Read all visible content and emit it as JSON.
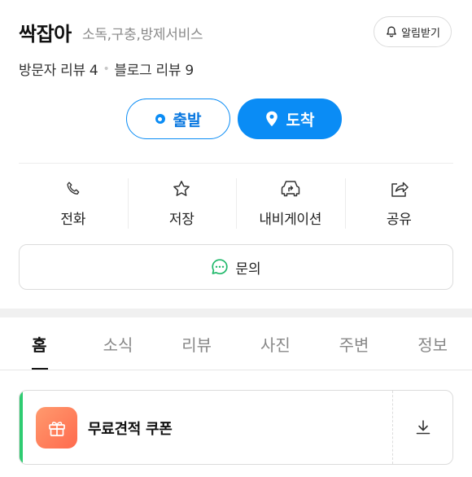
{
  "place": {
    "name": "싹잡아",
    "category": "소독,구충,방제서비스",
    "alarm_label": "알림받기",
    "visitor_reviews": "방문자 리뷰 4",
    "blog_reviews": "블로그 리뷰 9",
    "separator": "•"
  },
  "route": {
    "depart_label": "출발",
    "arrive_label": "도착"
  },
  "actions": [
    {
      "label": "전화",
      "icon": "phone-icon"
    },
    {
      "label": "저장",
      "icon": "star-icon"
    },
    {
      "label": "내비게이션",
      "icon": "navigation-car-icon"
    },
    {
      "label": "공유",
      "icon": "share-icon"
    }
  ],
  "inquiry": {
    "label": "문의",
    "icon": "chat-bubble-icon"
  },
  "tabs": [
    {
      "label": "홈",
      "active": true
    },
    {
      "label": "소식"
    },
    {
      "label": "리뷰"
    },
    {
      "label": "사진"
    },
    {
      "label": "주변"
    },
    {
      "label": "정보"
    }
  ],
  "coupon": {
    "title": "무료견적 쿠폰",
    "icon": "gift-icon",
    "download_icon": "download-icon"
  },
  "colors": {
    "accent_blue": "#0a8cf5",
    "coupon_accent": "#2ecc71",
    "coupon_icon_bg": "#ff7a55",
    "inquiry_icon": "#1fb86a"
  }
}
